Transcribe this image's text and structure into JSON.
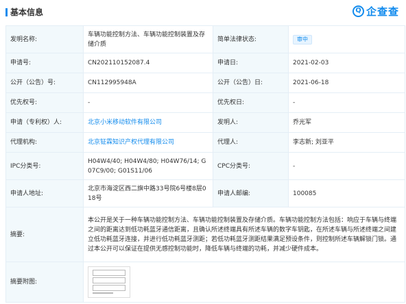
{
  "header": {
    "title": "基本信息",
    "logo_text": "企查查",
    "logo_icon": "qichacha-logo-icon"
  },
  "colors": {
    "accent": "#128bed",
    "label_bg": "#f2f9fc",
    "border": "#e4eef6"
  },
  "rows": {
    "invention_name": {
      "label": "发明名称:",
      "value": "车辆功能控制方法、车辆功能控制装置及存储介质"
    },
    "legal_status": {
      "label": "简单法律状态:",
      "value": "审中"
    },
    "app_no": {
      "label": "申请号:",
      "value": "CN202110152087.4"
    },
    "app_date": {
      "label": "申请日:",
      "value": "2021-02-03"
    },
    "pub_no": {
      "label": "公开（公告）号:",
      "value": "CN112995948A"
    },
    "pub_date": {
      "label": "公开（公告）日:",
      "value": "2021-06-18"
    },
    "priority_no": {
      "label": "优先权号:",
      "value": "-"
    },
    "priority_date": {
      "label": "优先权日:",
      "value": "-"
    },
    "applicant": {
      "label": "申请（专利权）人:",
      "value": "北京小米移动软件有限公司"
    },
    "inventor": {
      "label": "发明人:",
      "value": "乔光军"
    },
    "agency": {
      "label": "代理机构:",
      "value": "北京钲霖知识产权代理有限公司"
    },
    "agent": {
      "label": "代理人:",
      "value": "李志新; 刘亚平"
    },
    "ipc": {
      "label": "IPC分类号:",
      "value": "H04W4/40;  H04W4/80;  H04W76/14;  G07C9/00;  G01S11/06"
    },
    "cpc": {
      "label": "CPC分类号:",
      "value": "-"
    },
    "address": {
      "label": "申请人地址:",
      "value": "北京市海淀区西二旗中路33号院6号楼8层018号"
    },
    "postcode": {
      "label": "申请人邮编:",
      "value": "100085"
    },
    "abstract": {
      "label": "摘要:",
      "value": "本公开是关于一种车辆功能控制方法、车辆功能控制装置及存储介质。车辆功能控制方法包括：响应于车辆与终端之间的距离达到低功耗蓝牙通信距离，且确认所述终端具有所述车辆的数字车钥匙，在所述车辆与所述终端之间建立低功耗蓝牙连接，并进行低功耗蓝牙测距；若低功耗蓝牙测距结果满足预设条件，则控制所述车辆解锁门锁。通过本公开可以保证在提供无感控制功能时，降低车辆与终端的功耗，并减少硬件成本。"
    },
    "abstract_figure": {
      "label": "摘要附图:",
      "icon": "flowchart-thumbnail-icon"
    }
  }
}
